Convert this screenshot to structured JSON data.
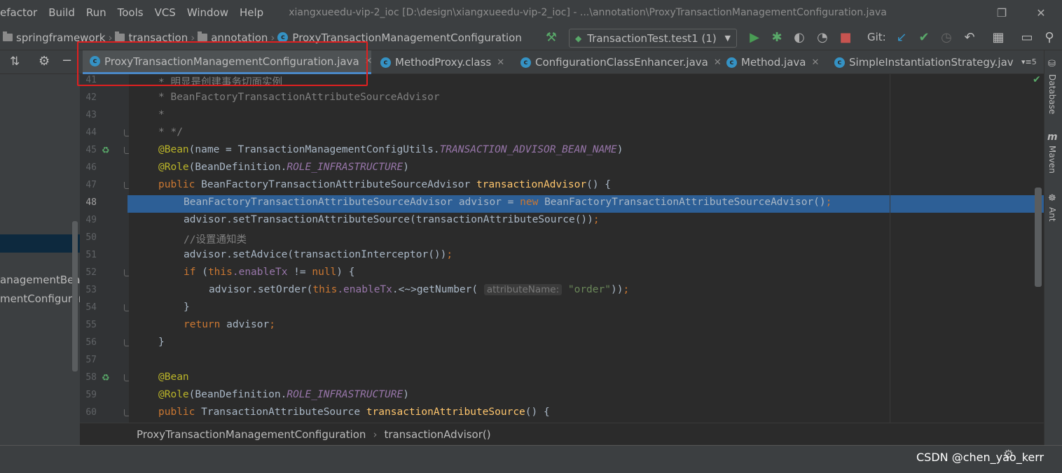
{
  "menu": [
    "efactor",
    "Build",
    "Run",
    "Tools",
    "VCS",
    "Window",
    "Help"
  ],
  "window_title": "xiangxueedu-vip-2_ioc [D:\\design\\xiangxueedu-vip-2_ioc] - ...\\annotation\\ProxyTransactionManagementConfiguration.java",
  "nav": {
    "crumbs": [
      "springframework",
      "transaction",
      "annotation"
    ],
    "file": "ProxyTransactionManagementConfiguration",
    "run_config": "TransactionTest.test1 (1)",
    "git": "Git:"
  },
  "tabs": [
    "ProxyTransactionManagementConfiguration.java",
    "MethodProxy.class",
    "ConfigurationClassEnhancer.java",
    "Method.java",
    "SimpleInstantiationStrategy.jav"
  ],
  "tabs_more": "5",
  "left_panel": [
    "anagementBear",
    "mentConfigurer"
  ],
  "lines": [
    "41",
    "42",
    "43",
    "44",
    "45",
    "46",
    "47",
    "48",
    "49",
    "50",
    "51",
    "52",
    "53",
    "54",
    "55",
    "56",
    "57",
    "58",
    "59",
    "60"
  ],
  "code": {
    "l41": "* 明显是创建事务切面实例",
    "l42": "* BeanFactoryTransactionAttributeSourceAdvisor",
    "l43": "*",
    "l44": "* */",
    "bean": "@Bean",
    "role": "@Role",
    "l45a": "(name = TransactionManagementConfigUtils.",
    "l45b": "TRANSACTION_ADVISOR_BEAN_NAME",
    "l46a": "(BeanDefinition.",
    "l46b": "ROLE_INFRASTRUCTURE",
    "paren": ")",
    "public": "public ",
    "l47a": "BeanFactoryTransactionAttributeSourceAdvisor ",
    "l47b": "transactionAdvisor",
    "l47c": "() {",
    "l48a": "BeanFactoryTransactionAttributeSourceAdvisor advisor = ",
    "new": "new ",
    "l48b": "BeanFactoryTransactionAttributeSourceAdvisor()",
    "semi": ";",
    "l49": "advisor.setTransactionAttributeSource(transactionAttributeSource())",
    "l50": "//设置通知类",
    "l51": "advisor.setAdvice(transactionInterceptor())",
    "if": "if ",
    "this": "this",
    "l52a": "(",
    "dotEnable": ".enableTx",
    "l52b": " != ",
    "null": "null",
    "l52c": ") {",
    "l53a": "advisor.setOrder(",
    "l53b": ".<~>getNumber(",
    "hint": "attributeName:",
    "l53c": "\"order\"",
    "l53d": "))",
    "brace": "}",
    "return": "return ",
    "l55": "advisor",
    "l60a": "TransactionAttributeSource ",
    "l60b": "transactionAttributeSource",
    "l60c": "() {"
  },
  "breadcrumb": [
    "ProxyTransactionManagementConfiguration",
    "transactionAdvisor()"
  ],
  "right_tools": [
    "Database",
    "Maven",
    "Ant"
  ],
  "watermark": "CSDN @chen_yao_kerr"
}
